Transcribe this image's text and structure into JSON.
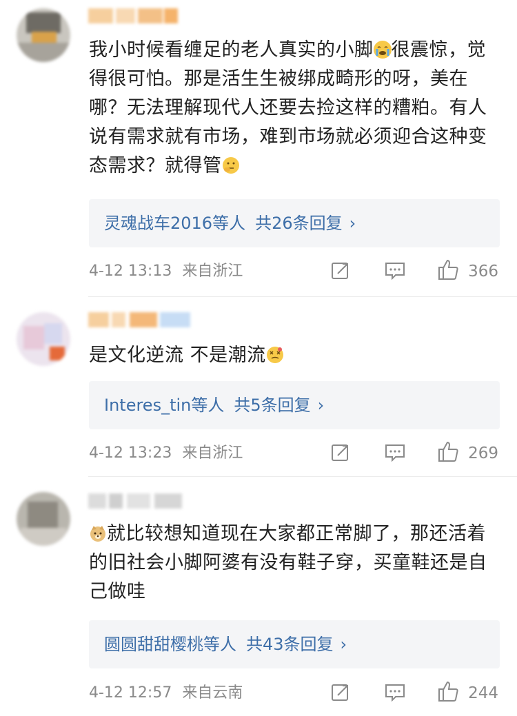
{
  "comments": [
    {
      "text_before_emoji": "我小时候看缠足的老人真实的小脚",
      "text_after_emoji": "很震惊，觉得很可怕。那是活生生被绑成畸形的呀，美在哪？无法理解现代人还要去捡这样的糟粕。有人说有需求就有市场，难到市场就必须迎合这种变态需求？就得管",
      "emoji_1": "crying-emoji",
      "emoji_2": "thinking-emoji",
      "reply_users": "灵魂战车2016等人",
      "reply_count": "共26条回复",
      "time": "4-12 13:13",
      "location": "来自浙江",
      "likes": "366"
    },
    {
      "text_before_emoji": "是文化逆流  不是潮流",
      "emoji_1": "dizzy-emoji",
      "reply_users": "Interes_tin等人",
      "reply_count": "共5条回复",
      "time": "4-12 13:23",
      "location": "来自浙江",
      "likes": "269"
    },
    {
      "emoji_1": "doge-emoji",
      "text_after_emoji": "就比较想知道现在大家都正常脚了，那还活着的旧社会小脚阿婆有没有鞋子穿，买童鞋还是自己做哇",
      "reply_users": "圆圆甜甜樱桃等人",
      "reply_count": "共43条回复",
      "time": "4-12 12:57",
      "location": "来自云南",
      "likes": "244"
    }
  ],
  "chevron": "›",
  "colors": {
    "link": "#3d6ea8",
    "meta": "#8a8a8a",
    "reply_bg": "#f4f5f7",
    "emoji_yellow": "#f7c948"
  }
}
